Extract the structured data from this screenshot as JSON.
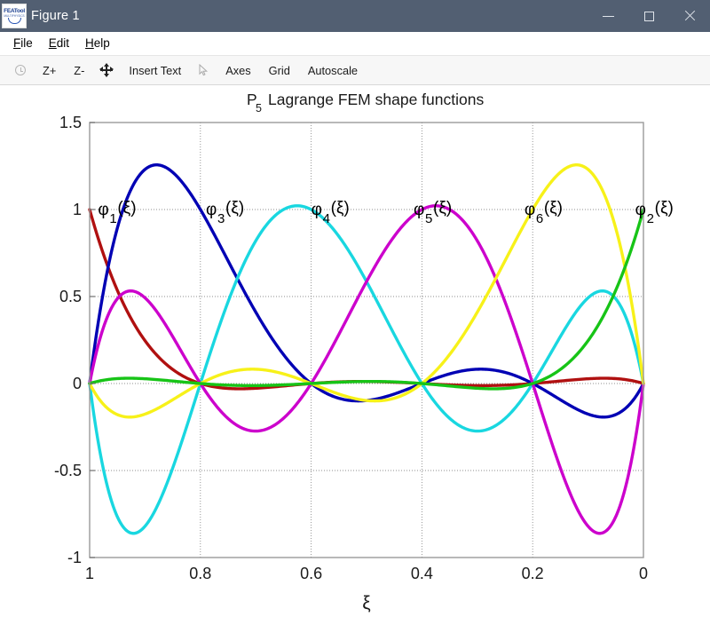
{
  "window": {
    "title": "Figure 1",
    "logo_text": "FEATool",
    "logo_sub": "MULTIPHYSICS",
    "titlebar_color": "#525F72",
    "controls": [
      {
        "name": "minimize",
        "label": "Minimize"
      },
      {
        "name": "maximize",
        "label": "Maximize"
      },
      {
        "name": "close",
        "label": "Close"
      }
    ]
  },
  "menubar": {
    "items": [
      {
        "label": "File",
        "mnemonic": "F"
      },
      {
        "label": "Edit",
        "mnemonic": "E"
      },
      {
        "label": "Help",
        "mnemonic": "H"
      }
    ]
  },
  "toolbar": {
    "items": [
      {
        "label": "",
        "icon": "reset-clock-icon",
        "type": "icon"
      },
      {
        "label": "Z+",
        "icon": "zoom-in-icon",
        "type": "text"
      },
      {
        "label": "Z-",
        "icon": "zoom-out-icon",
        "type": "text"
      },
      {
        "label": "",
        "icon": "pan-move-icon",
        "type": "icon"
      },
      {
        "label": "Insert Text",
        "icon": "insert-text-icon",
        "type": "text"
      },
      {
        "label": "",
        "icon": "cursor-arrow-icon",
        "type": "icon"
      },
      {
        "label": "Axes",
        "icon": "axes-icon",
        "type": "text"
      },
      {
        "label": "Grid",
        "icon": "grid-icon",
        "type": "text"
      },
      {
        "label": "Autoscale",
        "icon": "autoscale-icon",
        "type": "text"
      }
    ]
  },
  "chart_data": {
    "type": "line",
    "title": "P5 Lagrange FEM shape functions",
    "title_base": "P",
    "title_sub": "5",
    "title_rest": "Lagrange FEM shape functions",
    "xlabel": "ξ",
    "ylabel": "",
    "xlim": [
      1,
      0
    ],
    "ylim": [
      -1,
      1.5
    ],
    "x_reversed": true,
    "grid": true,
    "xticks": [
      1,
      0.8,
      0.6,
      0.4,
      0.2,
      0
    ],
    "xticklabels": [
      "1",
      "0.8",
      "0.6",
      "0.4",
      "0.2",
      "0"
    ],
    "yticks": [
      -1,
      -0.5,
      0,
      0.5,
      1,
      1.5
    ],
    "yticklabels": [
      "-1",
      "-0.5",
      "0",
      "0.5",
      "1",
      "1.5"
    ],
    "nodes": [
      1,
      0.8,
      0.6,
      0.4,
      0.2,
      0
    ],
    "series": [
      {
        "name": "phi1",
        "label": "φ",
        "sub": "1",
        "arg": "(ξ)",
        "color": "#B01010",
        "node": 1,
        "label_x": 0.985,
        "label_y": 1.0,
        "peak_description": "value 1 at xi=1, decays to 0 through all other nodes"
      },
      {
        "name": "phi3",
        "label": "φ",
        "sub": "3",
        "arg": "(ξ)",
        "color": "#0000B4",
        "node": 0.8,
        "label_x": 0.79,
        "label_y": 1.0,
        "peak_value": 1.27,
        "peak_at": 0.885
      },
      {
        "name": "phi4",
        "label": "φ",
        "sub": "4",
        "arg": "(ξ)",
        "color": "#19D7E0",
        "node": 0.6,
        "label_x": 0.6,
        "label_y": 1.0,
        "peak_value": 1.1,
        "min_value": -0.87
      },
      {
        "name": "phi5",
        "label": "φ",
        "sub": "5",
        "arg": "(ξ)",
        "color": "#CC00CC",
        "node": 0.4,
        "label_x": 0.415,
        "label_y": 1.0,
        "peak_value": 1.05,
        "min_value": -0.87
      },
      {
        "name": "phi6",
        "label": "φ",
        "sub": "6",
        "arg": "(ξ)",
        "color": "#F7F119",
        "node": 0.2,
        "label_x": 0.215,
        "label_y": 1.0,
        "peak_value": 1.27,
        "peak_at": 0.115
      },
      {
        "name": "phi2",
        "label": "φ",
        "sub": "2",
        "arg": "(ξ)",
        "color": "#17C417",
        "node": 0,
        "label_x": 0.015,
        "label_y": 1.0,
        "peak_description": "value 1 at xi=0"
      }
    ]
  }
}
